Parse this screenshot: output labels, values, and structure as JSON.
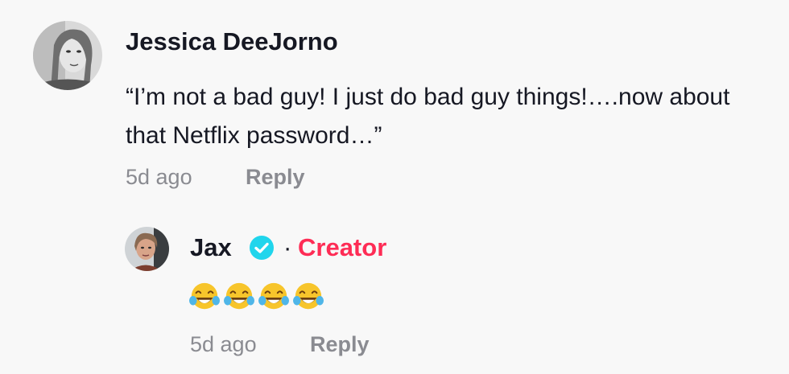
{
  "comment": {
    "username": "Jessica DeeJorno",
    "text": "“I’m not a bad guy! I just do bad guy things!….now about that Netflix password…”",
    "time": "5d ago",
    "reply_label": "Reply",
    "avatar_icon": "user-avatar-icon"
  },
  "reply": {
    "username": "Jax",
    "verified_icon": "verified-check-icon",
    "verified_color": "#20d5ec",
    "separator": "·",
    "badge": "Creator",
    "badge_color": "#fe2c55",
    "emojis": [
      "face-with-tears-of-joy-icon",
      "face-with-tears-of-joy-icon",
      "face-with-tears-of-joy-icon",
      "face-with-tears-of-joy-icon"
    ],
    "time": "5d ago",
    "reply_label": "Reply",
    "avatar_icon": "user-avatar-icon"
  }
}
